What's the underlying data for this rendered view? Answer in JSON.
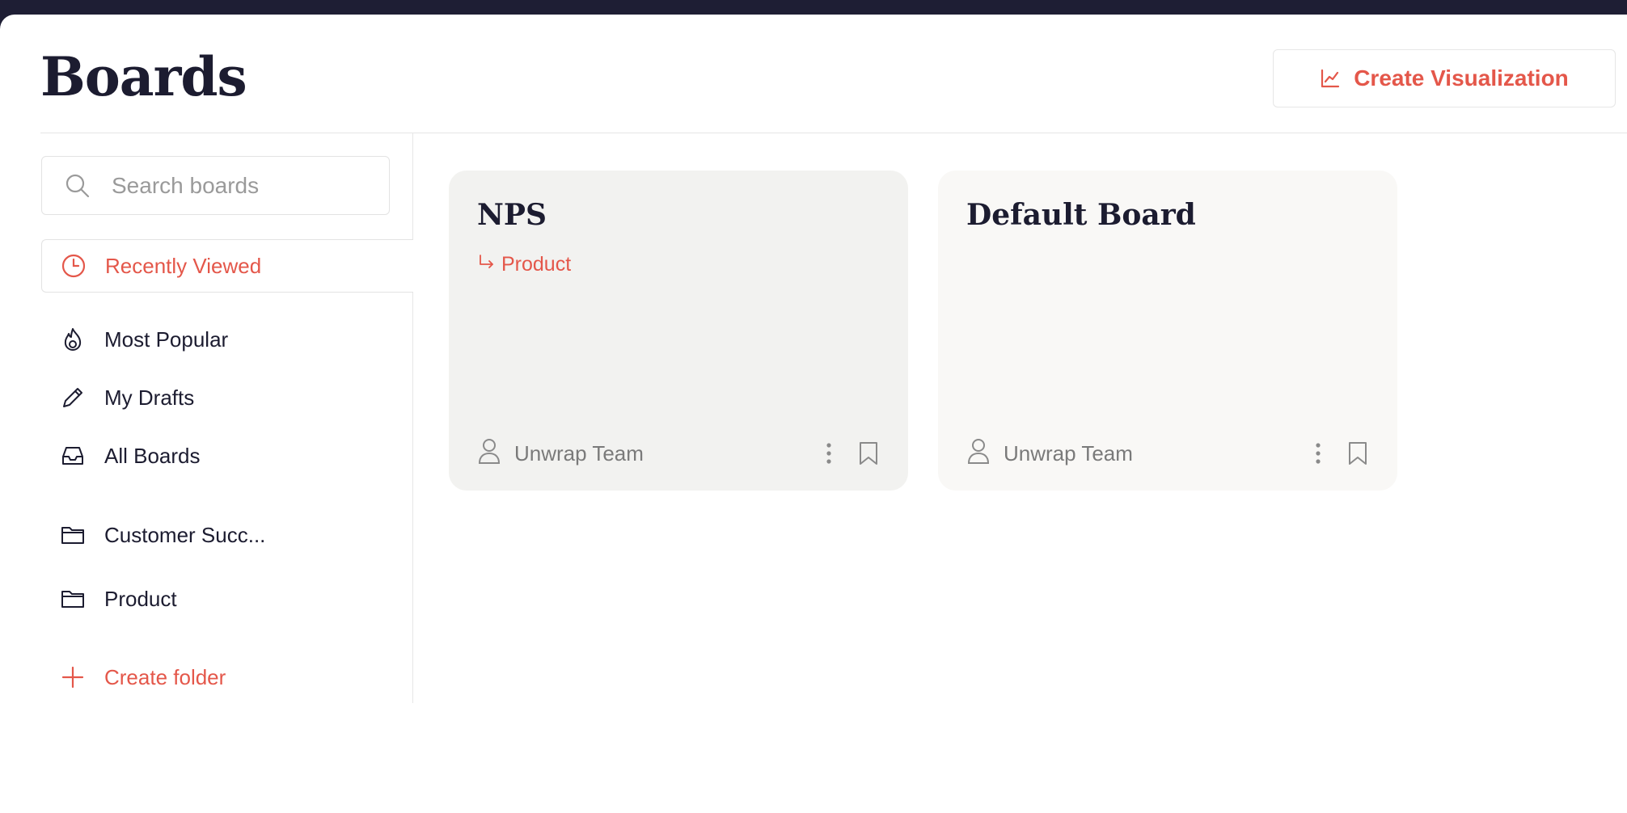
{
  "page": {
    "title": "Boards",
    "create_visualization_label": "Create Visualization"
  },
  "search": {
    "placeholder": "Search boards"
  },
  "sidebar": {
    "items": [
      {
        "label": "Recently Viewed",
        "icon": "clock-icon",
        "active": true
      },
      {
        "label": "Most Popular",
        "icon": "flame-icon"
      },
      {
        "label": "My Drafts",
        "icon": "pencil-icon"
      },
      {
        "label": "All Boards",
        "icon": "inbox-icon"
      }
    ],
    "folders": [
      {
        "label": "Customer Succ...",
        "icon": "folder-icon"
      },
      {
        "label": "Product",
        "icon": "folder-icon"
      }
    ],
    "create_folder_label": "Create folder"
  },
  "boards": [
    {
      "title": "NPS",
      "folder": "Product",
      "owner": "Unwrap Team"
    },
    {
      "title": "Default Board",
      "folder": "",
      "owner": "Unwrap Team"
    }
  ],
  "colors": {
    "accent": "#e4574a",
    "text": "#1c1c30",
    "muted": "#7a7a7a",
    "topbar": "#1e1e34"
  }
}
